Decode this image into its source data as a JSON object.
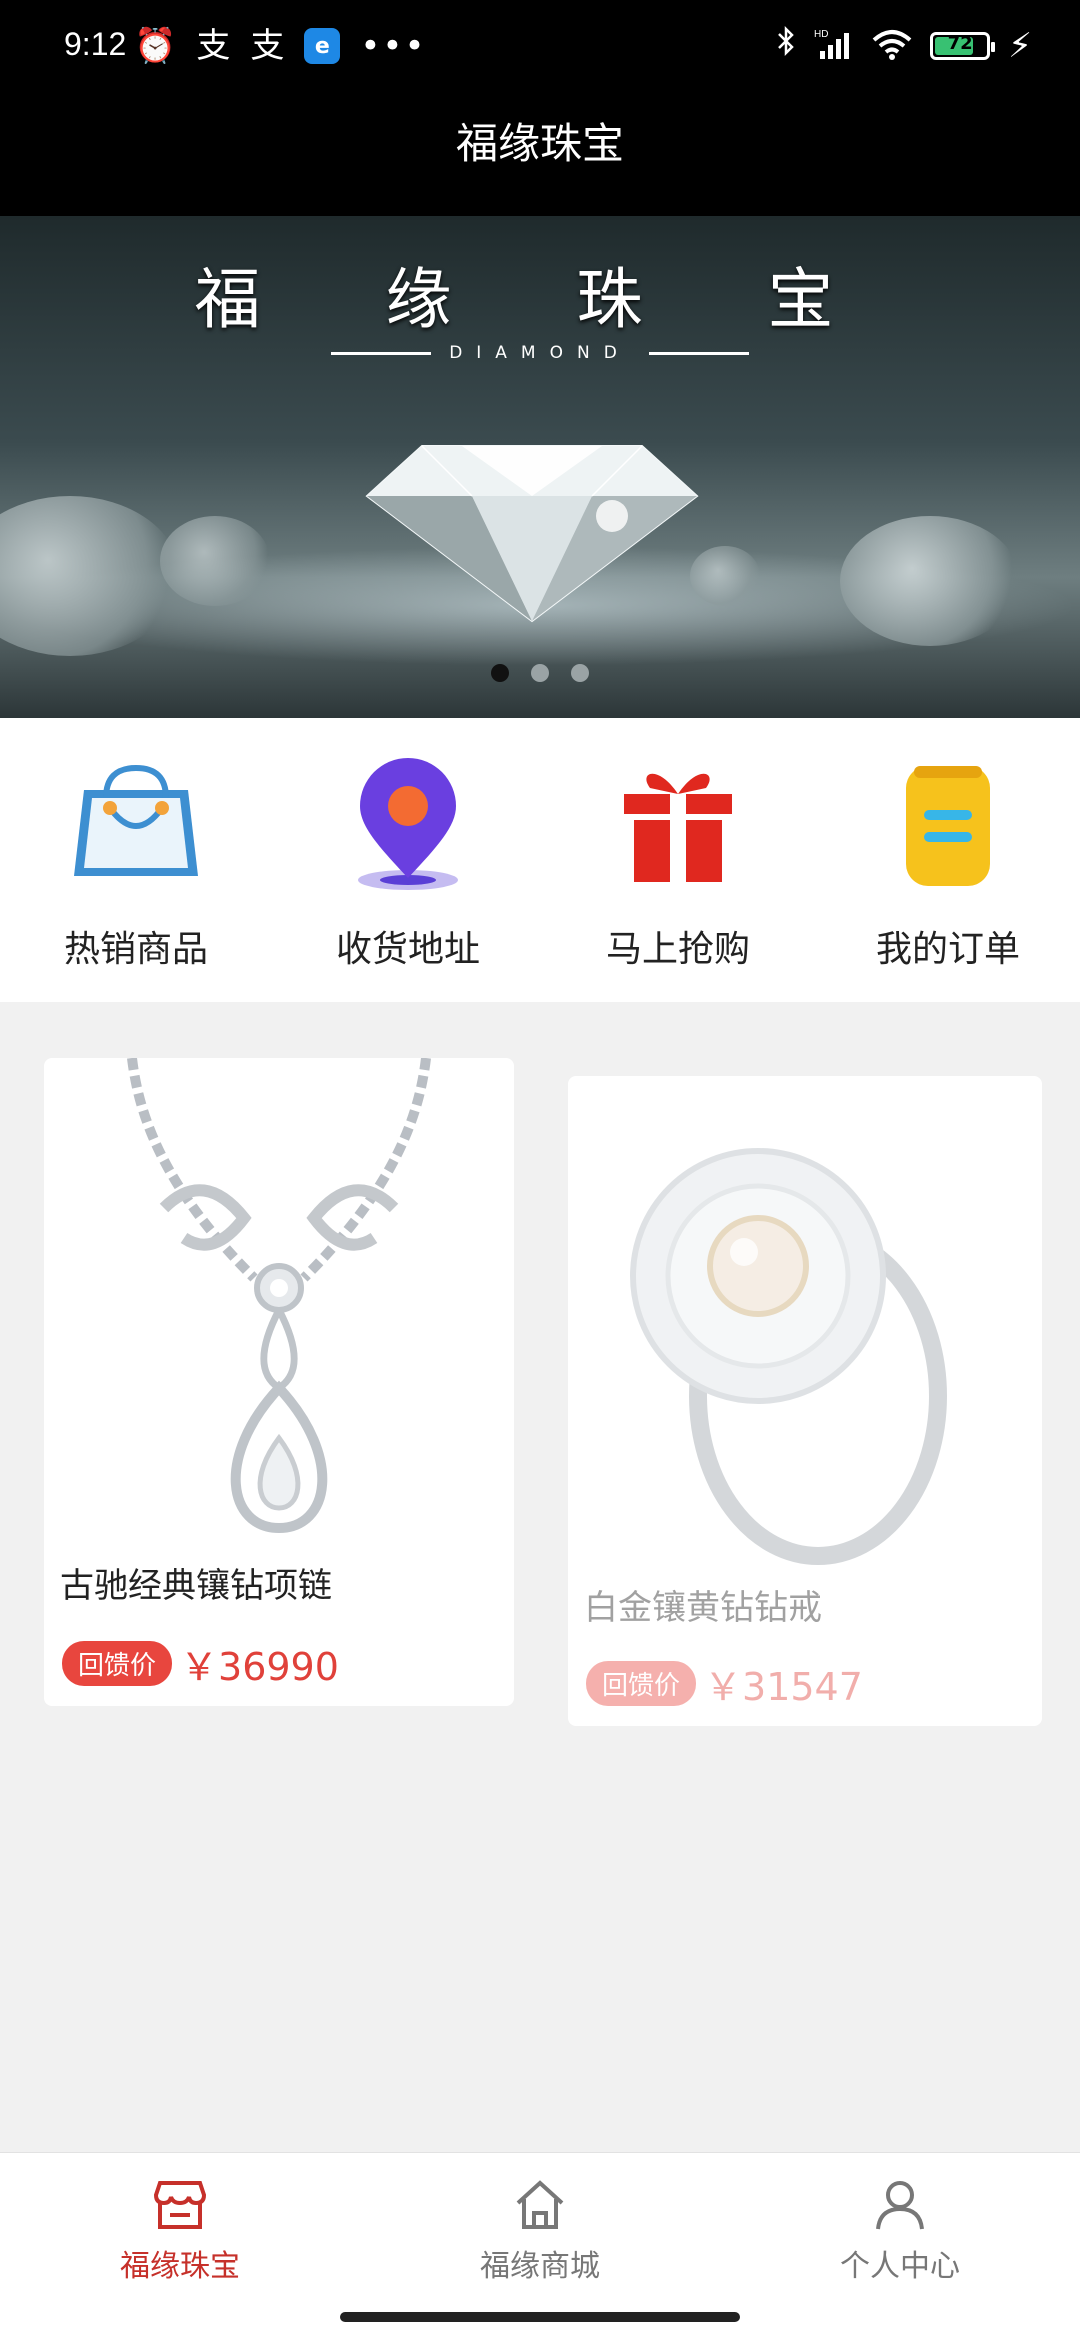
{
  "status_bar": {
    "time": "9:12",
    "left_icons": [
      "alarm-icon",
      "notification-icon",
      "notification-icon",
      "app-icon",
      "more-dots-icon"
    ],
    "right_icons": [
      "bluetooth-icon",
      "signal-hd-icon",
      "wifi-icon",
      "battery-icon",
      "charging-icon"
    ],
    "battery_level": "72"
  },
  "header": {
    "title": "福缘珠宝"
  },
  "banner": {
    "title": "福 缘 珠 宝",
    "subtitle": "DIAMOND",
    "slide_count": 3,
    "active_slide": 1
  },
  "quick_menu": [
    {
      "label": "热销商品",
      "icon": "shopping-bag-icon"
    },
    {
      "label": "收货地址",
      "icon": "location-pin-icon"
    },
    {
      "label": "马上抢购",
      "icon": "gift-icon"
    },
    {
      "label": "我的订单",
      "icon": "order-list-icon"
    }
  ],
  "products": [
    {
      "name": "古驰经典镶钻项链",
      "badge": "回馈价",
      "price": "￥36990",
      "image": "diamond-necklace"
    },
    {
      "name": "白金镶黄钻钻戒",
      "badge": "回馈价",
      "price": "￥31547",
      "image": "diamond-ring"
    }
  ],
  "bottom_nav": [
    {
      "label": "福缘珠宝",
      "icon": "store-icon",
      "active": true
    },
    {
      "label": "福缘商城",
      "icon": "home-icon",
      "active": false
    },
    {
      "label": "个人中心",
      "icon": "user-icon",
      "active": false
    }
  ],
  "colors": {
    "accent": "#e8463e",
    "header_bg": "#000000",
    "page_bg": "#f1f1f1"
  }
}
